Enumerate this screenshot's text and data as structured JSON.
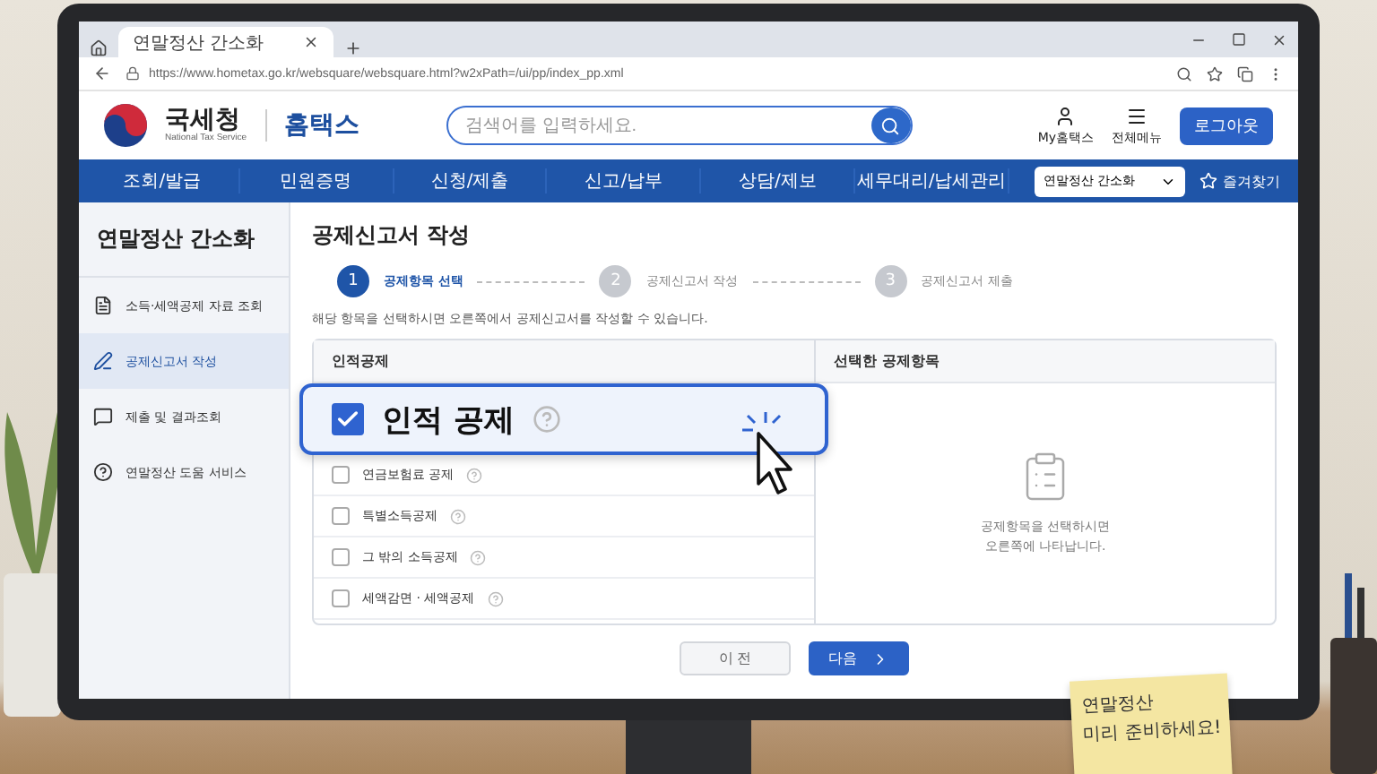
{
  "browser": {
    "tab_title": "연말정산 간소화",
    "url": "https://www.hometax.go.kr/websquare/websquare.html?w2xPath=/ui/pp/index_pp.xml"
  },
  "site": {
    "logo_name": "국세청",
    "logo_subtitle": "National Tax Service",
    "service_name": "홈택스",
    "search": {
      "placeholder": "검색어를 입력하세요."
    },
    "header_links": [
      {
        "label": "My홈택스",
        "kind": "user"
      },
      {
        "label": "전체메뉴",
        "kind": "menu"
      }
    ],
    "logout_button": "로그아웃"
  },
  "nav": {
    "items": [
      "조회/발급",
      "민원증명",
      "신청/제출",
      "신고/납부",
      "상담/제보",
      "세무대리/납세관리"
    ],
    "dropdown": {
      "value": "연말정산 간소화"
    },
    "favorites": "즐겨찾기"
  },
  "sidebar": {
    "title": "연말정산 간소화",
    "items": [
      {
        "label": "소득·세액공제 자료 조회",
        "kind": "file",
        "selected": false
      },
      {
        "label": "공제신고서 작성",
        "kind": "pen",
        "selected": true
      },
      {
        "label": "제출 및 결과조회",
        "kind": "chat",
        "selected": false
      },
      {
        "label": "연말정산 도움 서비스",
        "kind": "help",
        "selected": false
      }
    ]
  },
  "main": {
    "title": "공제신고서 작성",
    "steps": [
      {
        "number": "1",
        "label": "공제항목 선택",
        "selected": true
      },
      {
        "number": "2",
        "label": "공제신고서 작성",
        "selected": false
      },
      {
        "number": "3",
        "label": "공제신고서 제출",
        "selected": false
      }
    ],
    "instruction": "해당 항목을 선택하시면 오른쪽에서 공제신고서를 작성할 수 있습니다.",
    "left_panel": {
      "heading": "인적공제",
      "items": [
        {
          "label": "인적 공제",
          "selected": true,
          "checked": true
        },
        {
          "label": "연금보험료 공제",
          "selected": false,
          "checked": false
        },
        {
          "label": "특별소득공제",
          "selected": false,
          "checked": false
        },
        {
          "label": "그 밖의 소득공제",
          "selected": false,
          "checked": false
        },
        {
          "label": "세액감면 · 세액공제",
          "selected": false,
          "checked": false
        }
      ]
    },
    "right_panel": {
      "heading": "선택한 공제항목",
      "empty_message": [
        "공제항목을 선택하시면",
        "오른쪽에 나타납니다."
      ]
    },
    "buttons": [
      {
        "label": "이 전",
        "kind": "secondary"
      },
      {
        "label": "다음",
        "kind": "primary"
      }
    ]
  },
  "sticky_note": {
    "lines": [
      "연말정산",
      "미리 준비하세요!"
    ]
  }
}
